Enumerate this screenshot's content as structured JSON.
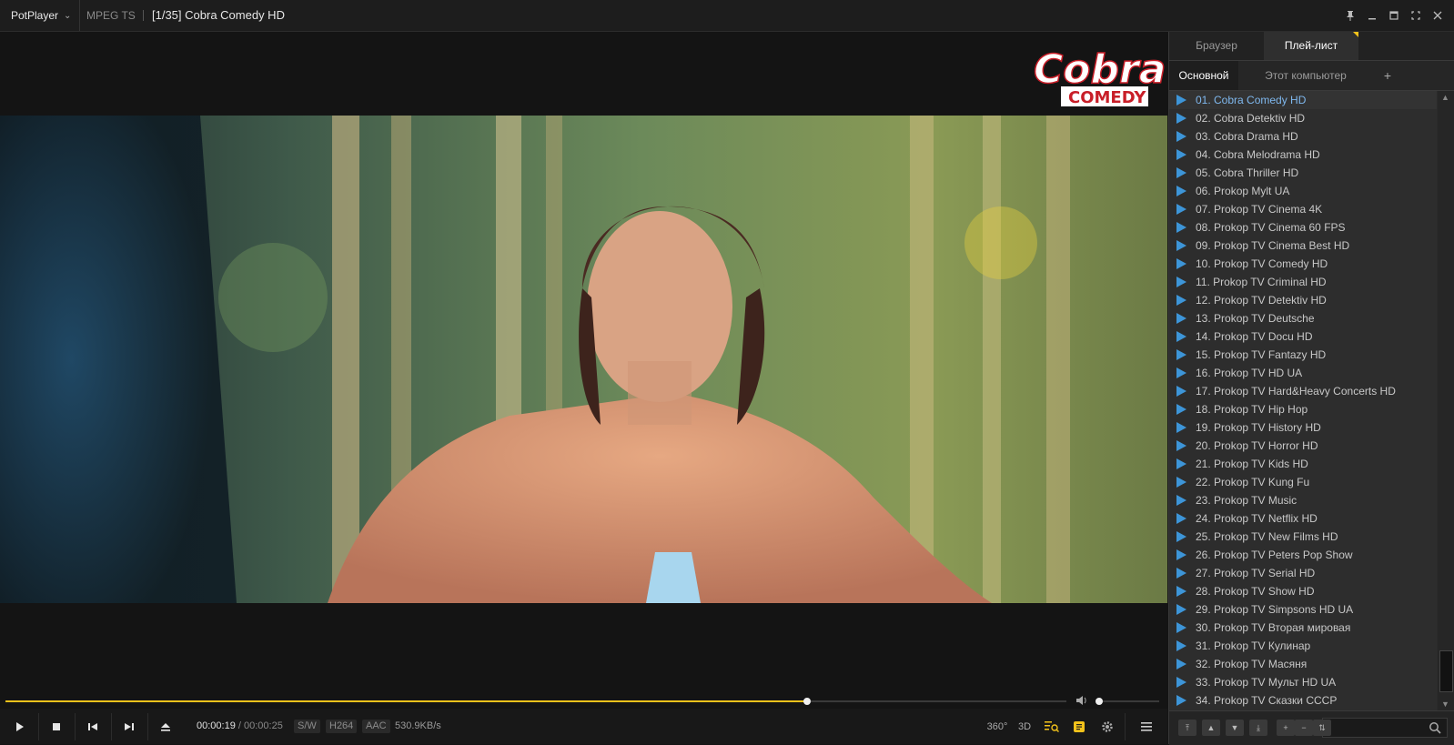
{
  "titlebar": {
    "app_name": "PotPlayer",
    "format": "MPEG TS",
    "title": "[1/35] Cobra Comedy HD"
  },
  "player": {
    "progress_fraction": 0.756,
    "volume_fraction": 0.05,
    "time_current": "00:00:19",
    "time_separator": "/",
    "time_total": "00:00:25",
    "badges": [
      "S/W",
      "H264",
      "AAC"
    ],
    "bitrate": "530.9KB/s",
    "btn_360": "360°",
    "btn_3d": "3D"
  },
  "logo": {
    "line1": "CobraTV",
    "line2": "COMEDY",
    "accent": "#c81e28"
  },
  "sidebar": {
    "tabs": [
      {
        "label": "Браузер"
      },
      {
        "label": "Плей-лист"
      }
    ],
    "subtabs": [
      {
        "label": "Основной"
      },
      {
        "label": "Этот компьютер"
      }
    ],
    "add_label": "+",
    "playlist": [
      "01. Cobra Comedy HD",
      "02. Cobra Detektiv HD",
      "03. Cobra Drama HD",
      "04. Cobra Melodrama HD",
      "05. Cobra Thriller HD",
      "06. Prokop Mylt UA",
      "07. Prokop TV Cinema 4K",
      "08. Prokop TV Cinema 60 FPS",
      "09. Prokop TV Cinema Best HD",
      "10. Prokop TV Comedy HD",
      "11. Prokop TV Criminal HD",
      "12. Prokop TV Detektiv HD",
      "13. Prokop TV Deutsche",
      "14. Prokop TV Docu HD",
      "15. Prokop TV Fantazy HD",
      "16. Prokop TV HD UA",
      "17. Prokop TV Hard&Heavy Concerts HD",
      "18. Prokop TV Hip Hop",
      "19. Prokop TV History HD",
      "20. Prokop TV Horror HD",
      "21. Prokop TV Kids HD",
      "22. Prokop TV Kung Fu",
      "23. Prokop TV Music",
      "24. Prokop TV Netflix HD",
      "25. Prokop TV New Films HD",
      "26. Prokop TV Peters Pop Show",
      "27. Prokop TV Serial HD",
      "28. Prokop TV Show HD",
      "29. Prokop TV Simpsons HD UA",
      "30. Prokop TV Вторая мировая",
      "31. Prokop TV Кулинар",
      "32. Prokop TV Масяня",
      "33. Prokop TV Мульт HD UA",
      "34. Prokop TV Сказки СССР"
    ],
    "bottom_buttons": [
      {
        "icon": "move-top-icon",
        "glyph": "⤒"
      },
      {
        "icon": "move-up-icon",
        "glyph": "▲"
      },
      {
        "icon": "move-down-icon",
        "glyph": "▼"
      },
      {
        "icon": "move-bottom-icon",
        "glyph": "⤓"
      },
      {
        "icon": "add-item-icon",
        "glyph": "+"
      },
      {
        "icon": "remove-item-icon",
        "glyph": "−"
      },
      {
        "icon": "sort-icon",
        "glyph": "⇅"
      }
    ]
  },
  "colors": {
    "accent_yellow": "#f2c21b",
    "active_item": "#7fb8ee",
    "play_icon": "#3d95d8"
  }
}
